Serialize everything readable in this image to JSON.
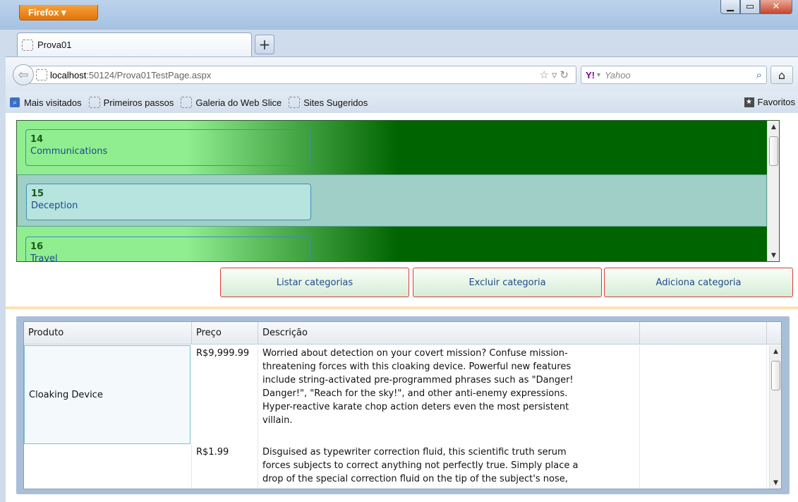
{
  "browser": {
    "menu_label": "Firefox",
    "tab_title": "Prova01",
    "url_host": "localhost",
    "url_rest": ":50124/Prova01TestPage.aspx",
    "search_engine": "Yahoo",
    "search_logo": "Y!"
  },
  "bookmarks": {
    "items": [
      "Mais visitados",
      "Primeiros passos",
      "Galeria do Web Slice",
      "Sites Sugeridos"
    ],
    "favorites_label": "Favoritos"
  },
  "categories": [
    {
      "id": "14",
      "name": "Communications"
    },
    {
      "id": "15",
      "name": "Deception"
    },
    {
      "id": "16",
      "name": "Travel"
    }
  ],
  "buttons": {
    "list": "Listar categorias",
    "delete": "Excluir categoria",
    "add": "Adiciona categoria"
  },
  "grid": {
    "headers": [
      "Produto",
      "Preço",
      "Descrição",
      ""
    ],
    "rows": [
      {
        "product": "Cloaking Device",
        "price": "R$9,999.99",
        "description": [
          "Worried about detection on your covert mission? Confuse mission-",
          "threatening forces with this cloaking device. Powerful new features",
          "include string-activated pre-programmed phrases such as \"Danger!",
          "Danger!\", \"Reach for the sky!\", and other anti-enemy expressions.",
          "Hyper-reactive karate chop action deters even the most persistent",
          "villain."
        ]
      },
      {
        "product": "",
        "price": "R$1.99",
        "description": [
          "Disguised as typewriter correction fluid, this scientific truth serum",
          "forces subjects to correct anything not perfectly true. Simply place a",
          "drop of the special correction fluid on the tip of the subject's nose,"
        ]
      }
    ]
  }
}
